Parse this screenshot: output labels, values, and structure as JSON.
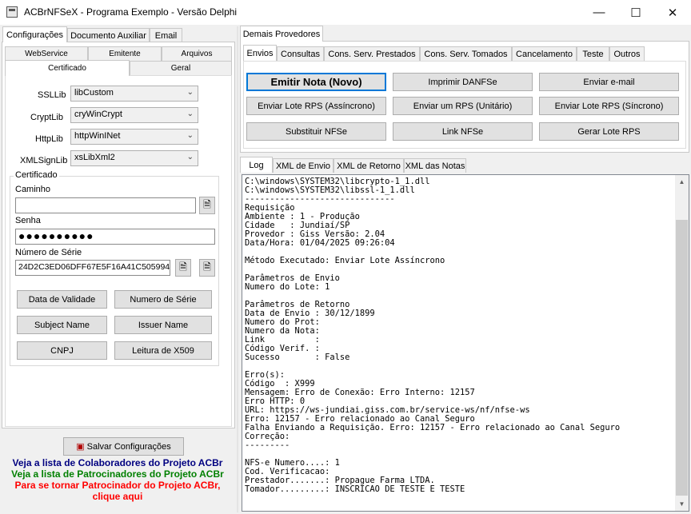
{
  "window": {
    "title": "ACBrNFSeX - Programa Exemplo - Versão Delphi"
  },
  "left": {
    "tabs": [
      "Configurações",
      "Documento Auxiliar",
      "Email"
    ],
    "subtabs_row1": [
      "WebService",
      "Emitente",
      "Arquivos"
    ],
    "subtabs_row2": [
      "Certificado",
      "Geral"
    ],
    "libs": [
      {
        "label": "SSLLib",
        "value": "libCustom"
      },
      {
        "label": "CryptLib",
        "value": "cryWinCrypt"
      },
      {
        "label": "HttpLib",
        "value": "httpWinINet"
      },
      {
        "label": "XMLSignLib",
        "value": "xsLibXml2"
      }
    ],
    "certificado": {
      "title": "Certificado",
      "caminho_label": "Caminho",
      "caminho_value": "",
      "senha_label": "Senha",
      "senha_value": "●●●●●●●●●●",
      "serie_label": "Número de Série",
      "serie_value": "24D2C3ED06DFF67E5F16A41C505994"
    },
    "buttons": [
      "Data de Validade",
      "Numero de Série",
      "Subject Name",
      "Issuer Name",
      "CNPJ",
      "Leitura de X509"
    ],
    "save_label": "Salvar Configurações",
    "links": {
      "colaboradores": "Veja a lista de Colaboradores do Projeto ACBr",
      "patrocinadores": "Veja a lista de Patrocinadores do Projeto ACBr",
      "patrocinar_1": "Para se tornar Patrocinador do Projeto ACBr,",
      "patrocinar_2": "clique aqui"
    },
    "link_colors": {
      "colaboradores": "#000080",
      "patrocinadores": "#008000",
      "patrocinar": "#ff0000"
    }
  },
  "right": {
    "tab": "Demais Provedores",
    "subtabs": [
      "Envios",
      "Consultas",
      "Cons. Serv. Prestados",
      "Cons. Serv. Tomados",
      "Cancelamento",
      "Teste",
      "Outros"
    ],
    "buttons": [
      "Emitir Nota (Novo)",
      "Imprimir DANFSe",
      "Enviar e-mail",
      "Enviar Lote RPS (Assíncrono)",
      "Enviar um RPS (Unitário)",
      "Enviar Lote RPS (Síncrono)",
      "Substituir NFSe",
      "Link NFSe",
      "Gerar Lote RPS"
    ],
    "log_tabs": [
      "Log",
      "XML de Envio",
      "XML de Retorno",
      "XML das Notas"
    ],
    "log_text": "C:\\windows\\SYSTEM32\\libcrypto-1_1.dll\nC:\\windows\\SYSTEM32\\libssl-1_1.dll\n------------------------------\nRequisição\nAmbiente : 1 - Produção\nCidade   : Jundiaí/SP\nProvedor : Giss Versão: 2.04\nData/Hora: 01/04/2025 09:26:04\n\nMétodo Executado: Enviar Lote Assíncrono\n\nParâmetros de Envio\nNumero do Lote: 1\n\nParâmetros de Retorno\nData de Envio : 30/12/1899\nNumero do Prot:\nNumero da Nota:\nLink          :\nCódigo Verif. :\nSucesso       : False\n\nErro(s):\nCódigo  : X999\nMensagem: Erro de Conexão: Erro Interno: 12157\nErro HTTP: 0\nURL: https://ws-jundiai.giss.com.br/service-ws/nf/nfse-ws\nErro: 12157 - Erro relacionado ao Canal Seguro\nFalha Enviando a Requisição. Erro: 12157 - Erro relacionado ao Canal Seguro\nCorreção:\n---------\n\nNFS-e Numero....: 1\nCod. Verificacao:\nPrestador.......: Propague Farma LTDA.\nTomador.........: INSCRICAO DE TESTE E TESTE"
  }
}
